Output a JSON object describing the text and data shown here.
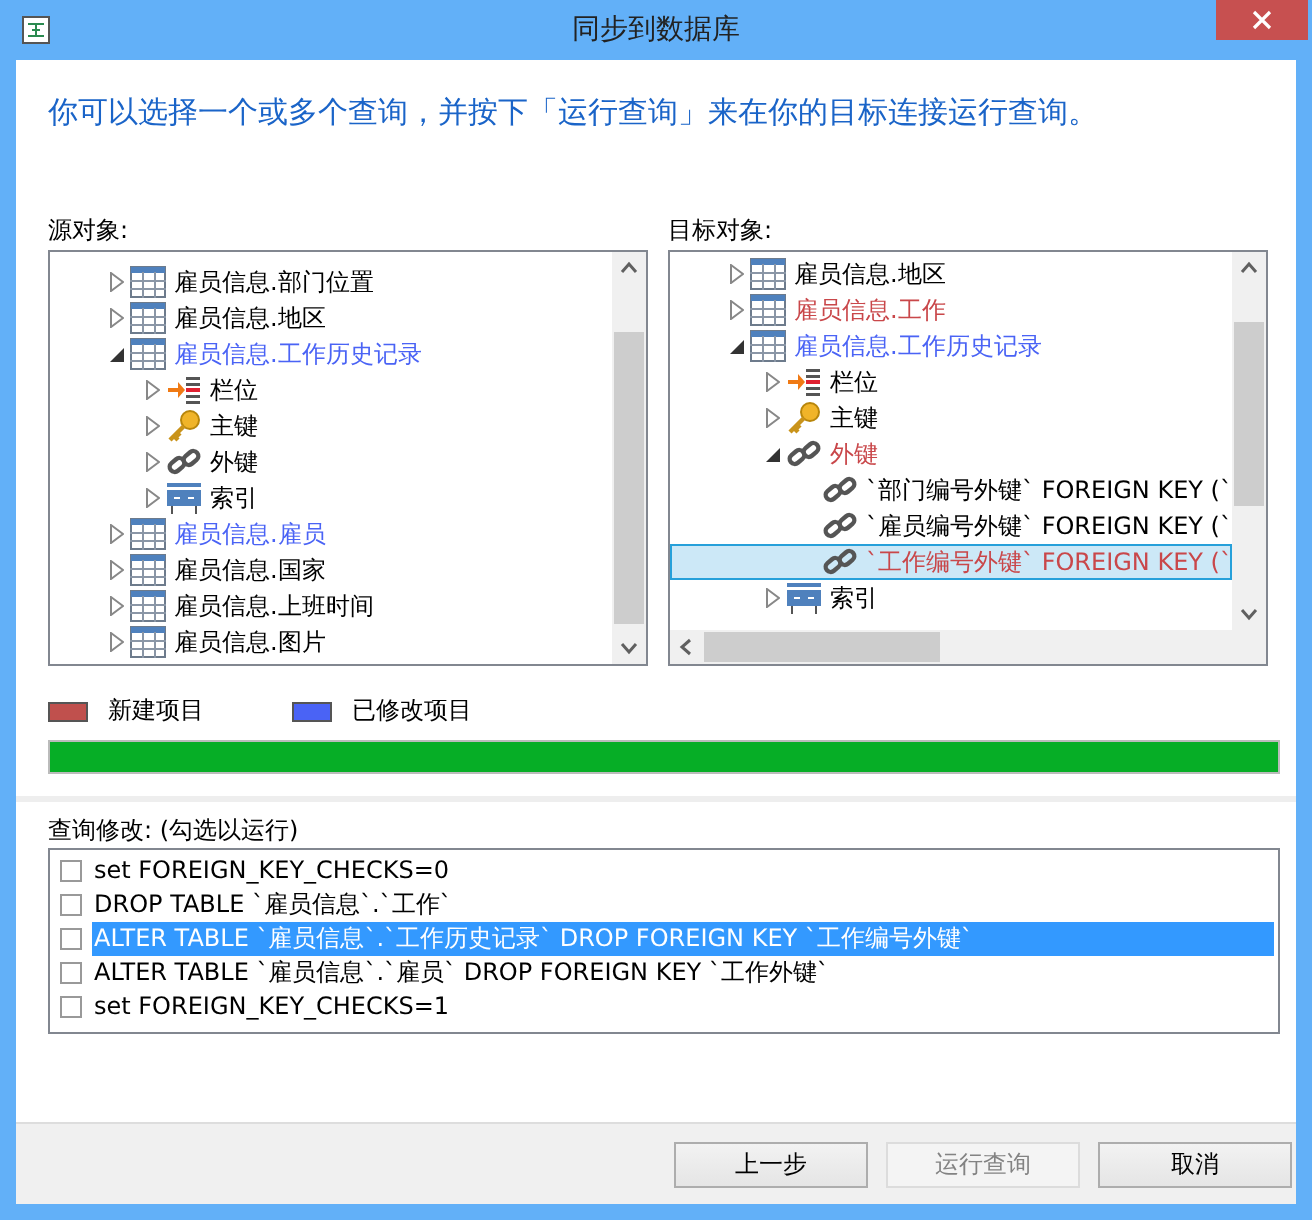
{
  "window": {
    "title": "同步到数据库"
  },
  "instruction": "你可以选择一个或多个查询，并按下「运行查询」来在你的目标连接运行查询。",
  "source": {
    "label": "源对象:",
    "items": [
      {
        "label": "雇员信息.部门位置",
        "kind": "table",
        "expanded": false,
        "selected": false
      },
      {
        "label": "雇员信息.地区",
        "kind": "table",
        "expanded": false,
        "selected": false
      },
      {
        "label": "雇员信息.工作历史记录",
        "kind": "table",
        "color": "#4a63f5",
        "expanded": true,
        "selected": false,
        "children": [
          {
            "label": "栏位",
            "kind": "columns",
            "expanded": false,
            "selected": false
          },
          {
            "label": "主键",
            "kind": "key",
            "expanded": false,
            "selected": false
          },
          {
            "label": "外键",
            "kind": "link",
            "expanded": false,
            "selected": false
          },
          {
            "label": "索引",
            "kind": "index",
            "expanded": false,
            "selected": false
          }
        ]
      },
      {
        "label": "雇员信息.雇员",
        "kind": "table",
        "color": "#4a63f5",
        "expanded": false,
        "selected": false
      },
      {
        "label": "雇员信息.国家",
        "kind": "table",
        "expanded": false,
        "selected": false
      },
      {
        "label": "雇员信息.上班时间",
        "kind": "table",
        "expanded": false,
        "selected": false
      },
      {
        "label": "雇员信息.图片",
        "kind": "table",
        "expanded": false,
        "selected": false
      }
    ]
  },
  "target": {
    "label": "目标对象:",
    "items": [
      {
        "label": "雇员信息.地区",
        "kind": "table",
        "expanded": false,
        "selected": false
      },
      {
        "label": "雇员信息.工作",
        "kind": "table",
        "color": "#c9474a",
        "expanded": false,
        "selected": false
      },
      {
        "label": "雇员信息.工作历史记录",
        "kind": "table",
        "color": "#4a63f5",
        "expanded": true,
        "selected": false,
        "children": [
          {
            "label": "栏位",
            "kind": "columns",
            "expanded": false,
            "selected": false
          },
          {
            "label": "主键",
            "kind": "key",
            "expanded": false,
            "selected": false
          },
          {
            "label": "外键",
            "kind": "link",
            "color": "#c9474a",
            "expanded": true,
            "selected": false,
            "children": [
              {
                "label": "`部门编号外键` FOREIGN KEY (`",
                "kind": "link",
                "selected": false
              },
              {
                "label": "`雇员编号外键` FOREIGN KEY (`",
                "kind": "link",
                "selected": false
              },
              {
                "label": "`工作编号外键` FOREIGN KEY (`",
                "kind": "link",
                "color": "#c9474a",
                "selected": true
              }
            ]
          },
          {
            "label": "索引",
            "kind": "index",
            "expanded": false,
            "selected": false
          }
        ]
      }
    ]
  },
  "legend": [
    {
      "label": "新建项目",
      "color": "#c0504d"
    },
    {
      "label": "已修改项目",
      "color": "#4a63f5"
    }
  ],
  "progress": {
    "level": 1
  },
  "queries": {
    "label": "查询修改: (勾选以运行)",
    "items": [
      {
        "text": "set FOREIGN_KEY_CHECKS=0",
        "checked": false,
        "selected": false
      },
      {
        "text": "DROP TABLE `雇员信息`.`工作`",
        "checked": false,
        "selected": false
      },
      {
        "text": "ALTER TABLE `雇员信息`.`工作历史记录` DROP FOREIGN KEY `工作编号外键`",
        "checked": false,
        "selected": true
      },
      {
        "text": "ALTER TABLE `雇员信息`.`雇员` DROP FOREIGN KEY `工作外键`",
        "checked": false,
        "selected": false
      },
      {
        "text": "set FOREIGN_KEY_CHECKS=1",
        "checked": false,
        "selected": false
      }
    ]
  },
  "buttons": [
    {
      "label": "上一步",
      "disabled": false
    },
    {
      "label": "运行查询",
      "disabled": true
    },
    {
      "label": "取消",
      "disabled": false
    }
  ]
}
